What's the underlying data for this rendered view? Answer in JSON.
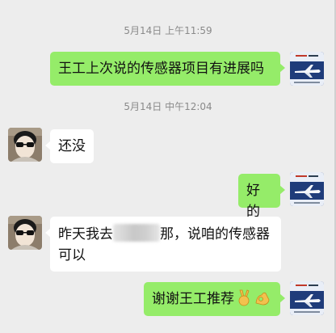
{
  "messages": [
    {
      "type": "timestamp",
      "text": "5月14日 上午11:59"
    },
    {
      "type": "outgoing",
      "text": "王工上次说的传感器项目有进展吗",
      "avatar": "airplane-avatar-icon"
    },
    {
      "type": "timestamp",
      "text": "5月14日 中午12:04"
    },
    {
      "type": "incoming",
      "text": "还没",
      "avatar": "person-sunglasses-avatar-icon"
    },
    {
      "type": "outgoing",
      "text": "好的",
      "avatar": "airplane-avatar-icon"
    },
    {
      "type": "incoming",
      "text_before": "昨天我去",
      "redacted": true,
      "text_after": "那，说咱的传感器",
      "text_line2": "可以",
      "avatar": "person-sunglasses-avatar-icon"
    },
    {
      "type": "outgoing",
      "text": "谢谢王工推荐",
      "emoji": [
        "victory-hand-emoji",
        "ok-hand-emoji"
      ],
      "avatar": "airplane-avatar-icon"
    }
  ],
  "colors": {
    "background": "#ededed",
    "outgoing_bubble": "#95ec69",
    "incoming_bubble": "#ffffff",
    "timestamp_text": "#8a8a8a"
  }
}
